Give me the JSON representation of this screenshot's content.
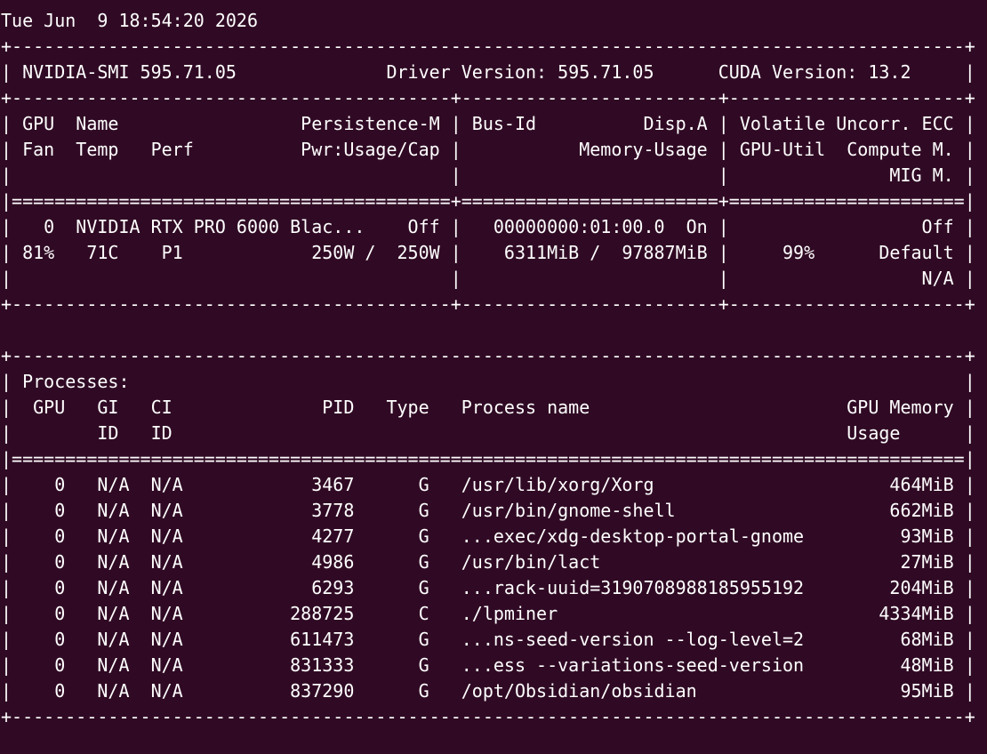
{
  "terminal": {
    "lines": [
      "Tue Jun  9 18:54:20 2026",
      "+-----------------------------------------------------------------------------------------+",
      "| NVIDIA-SMI 595.71.05              Driver Version: 595.71.05      CUDA Version: 13.2     |",
      "+-----------------------------------------+------------------------+----------------------+",
      "| GPU  Name                 Persistence-M | Bus-Id          Disp.A | Volatile Uncorr. ECC |",
      "| Fan  Temp   Perf          Pwr:Usage/Cap |           Memory-Usage | GPU-Util  Compute M. |",
      "|                                         |                        |               MIG M. |",
      "|=========================================+========================+======================|",
      "|   0  NVIDIA RTX PRO 6000 Blac...    Off |   00000000:01:00.0  On |                  Off |",
      "| 81%   71C    P1            250W /  250W |    6311MiB /  97887MiB |     99%      Default |",
      "|                                         |                        |                  N/A |",
      "+-----------------------------------------+------------------------+----------------------+",
      "",
      "+-----------------------------------------------------------------------------------------+",
      "| Processes:                                                                              |",
      "|  GPU   GI   CI              PID   Type   Process name                        GPU Memory |",
      "|        ID   ID                                                               Usage      |",
      "|=========================================================================================|",
      "|    0   N/A  N/A            3467      G   /usr/lib/xorg/Xorg                      464MiB |",
      "|    0   N/A  N/A            3778      G   /usr/bin/gnome-shell                    662MiB |",
      "|    0   N/A  N/A            4277      G   ...exec/xdg-desktop-portal-gnome         93MiB |",
      "|    0   N/A  N/A            4986      G   /usr/bin/lact                            27MiB |",
      "|    0   N/A  N/A            6293      G   ...rack-uuid=3190708988185955192        204MiB |",
      "|    0   N/A  N/A          288725      C   ./lpminer                              4334MiB |",
      "|    0   N/A  N/A          611473      G   ...ns-seed-version --log-level=2         68MiB |",
      "|    0   N/A  N/A          831333      G   ...ess --variations-seed-version         48MiB |",
      "|    0   N/A  N/A          837290      G   /opt/Obsidian/obsidian                   95MiB |",
      "+-----------------------------------------------------------------------------------------+"
    ]
  }
}
